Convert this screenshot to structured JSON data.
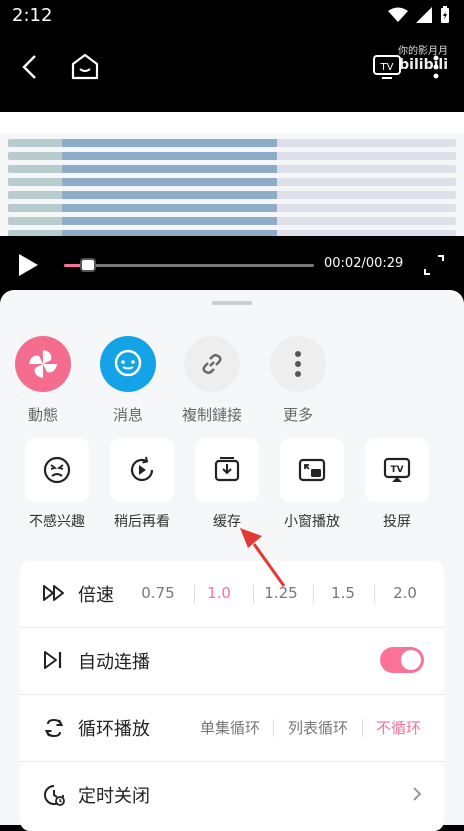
{
  "status": {
    "time": "2:12"
  },
  "video": {
    "watermark_top": "你的影月月",
    "watermark_brand": "bilibili",
    "time_display": "00:02/00:29",
    "progress_fraction": 0.07
  },
  "share_row": [
    {
      "label": "動態",
      "icon": "pinwheel-icon",
      "color": "#f46d8f"
    },
    {
      "label": "消息",
      "icon": "chat-bubble-icon",
      "color": "#14a3e6"
    },
    {
      "label": "複制鏈接",
      "icon": "link-icon",
      "color": "#eeeeee"
    },
    {
      "label": "更多",
      "icon": "more-dots-icon",
      "color": "#eeeeee"
    }
  ],
  "action_row": [
    {
      "label": "不感兴趣",
      "icon": "dislike-face-icon"
    },
    {
      "label": "稍后再看",
      "icon": "watch-later-icon"
    },
    {
      "label": "缓存",
      "icon": "download-icon"
    },
    {
      "label": "小窗播放",
      "icon": "mini-window-icon"
    },
    {
      "label": "投屏",
      "icon": "cast-tv-icon"
    }
  ],
  "settings": {
    "speed": {
      "title": "倍速",
      "options": [
        "0.75",
        "1.0",
        "1.25",
        "1.5",
        "2.0"
      ],
      "selected": "1.0"
    },
    "autoplay": {
      "title": "自动连播",
      "enabled": true
    },
    "loop": {
      "title": "循环播放",
      "options": [
        "单集循环",
        "列表循环",
        "不循环"
      ],
      "selected": "不循环"
    },
    "timer": {
      "title": "定时关闭"
    }
  },
  "colors": {
    "accent": "#fb7299"
  }
}
